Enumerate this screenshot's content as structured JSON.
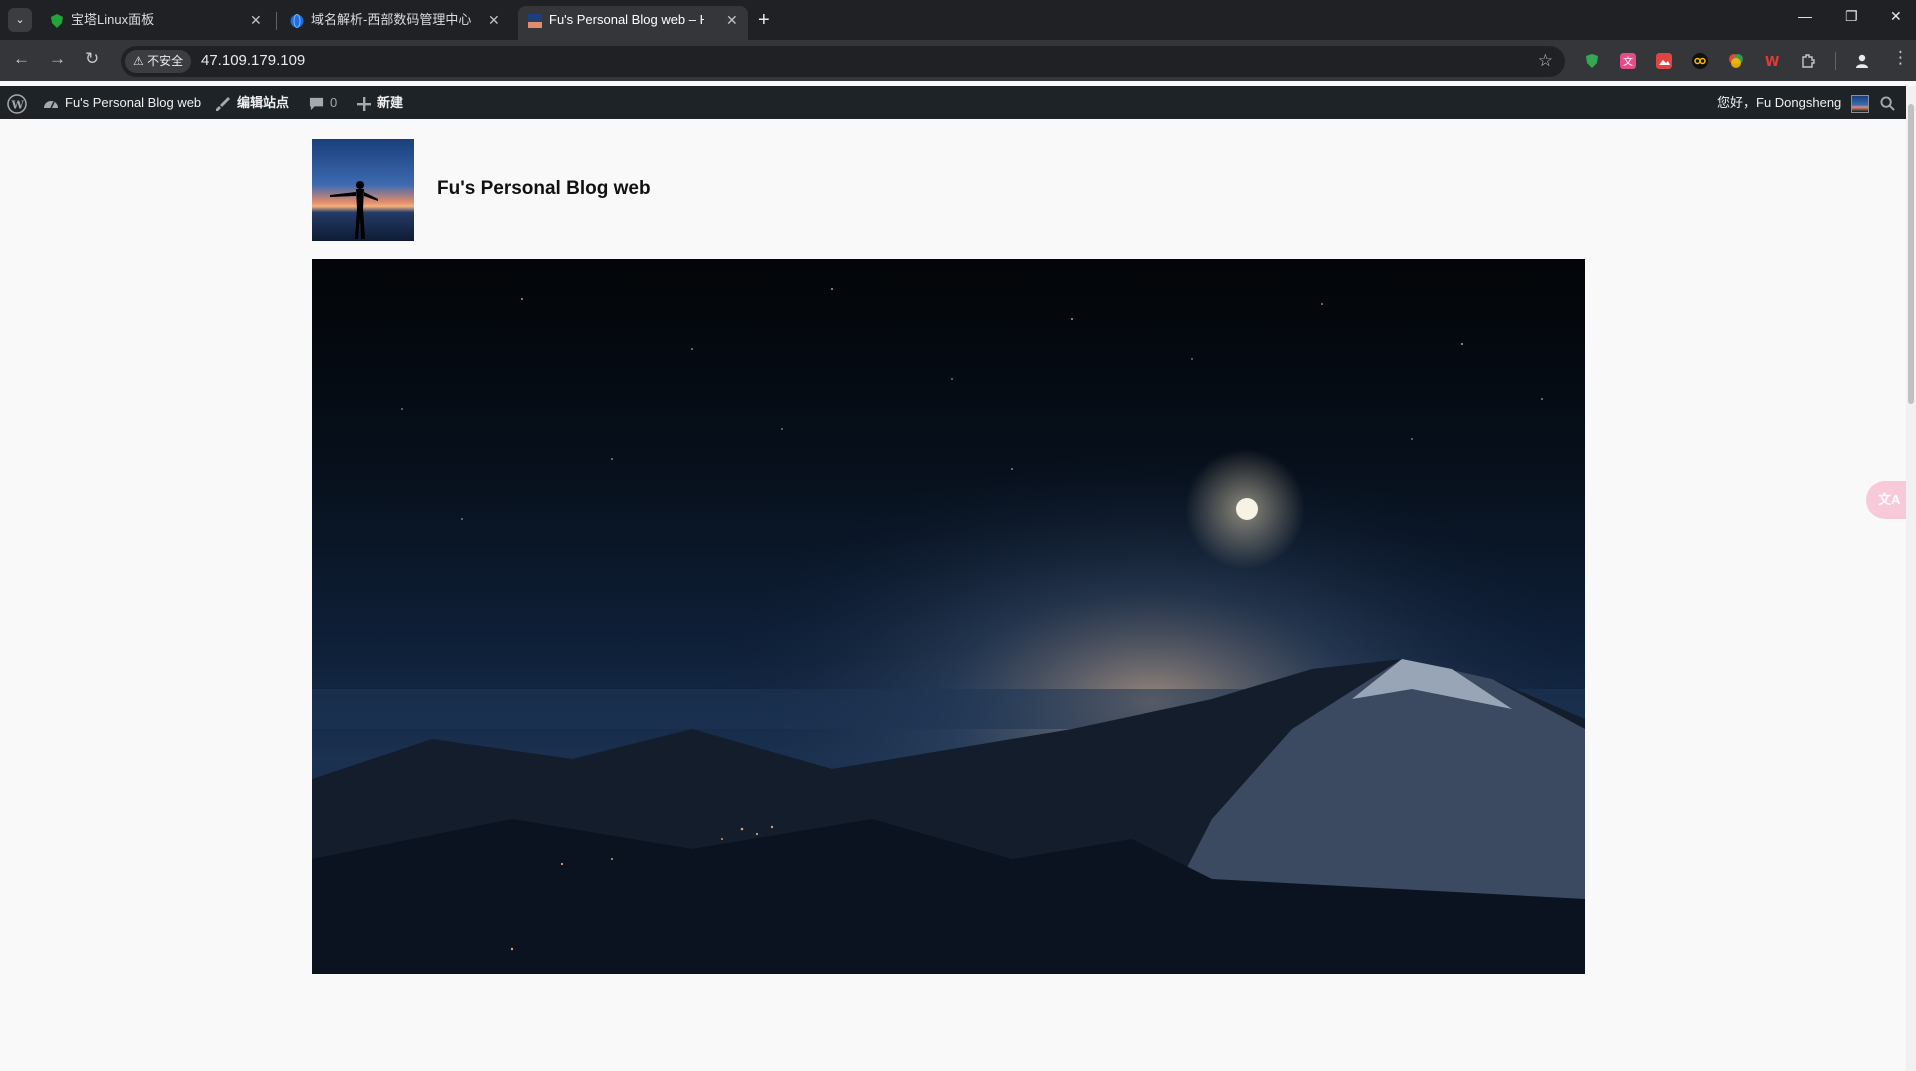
{
  "browser": {
    "tabs": [
      {
        "title": "宝塔Linux面板",
        "active": false
      },
      {
        "title": "域名解析-西部数码管理中心",
        "active": false
      },
      {
        "title": "Fu's Personal Blog web – Hi",
        "active": true
      }
    ],
    "security_label": "不安全",
    "url": "47.109.179.109"
  },
  "admin_bar": {
    "site_name": "Fu's Personal Blog web",
    "edit_site": "编辑站点",
    "comments_count": "0",
    "new_label": "新建",
    "greeting": "您好，Fu Dongsheng"
  },
  "site": {
    "title": "Fu's Personal Blog web"
  },
  "floating": {
    "translate_glyph": "文A"
  }
}
